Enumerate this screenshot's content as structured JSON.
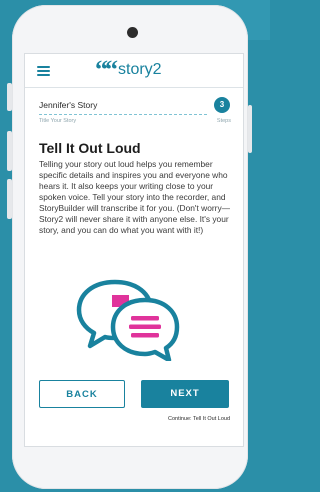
{
  "app": {
    "logo_text": "story2",
    "logo_mark": "““"
  },
  "story": {
    "name": "Jennifer's Story",
    "subtitle": "Title Your Story",
    "step_number": "3",
    "step_label": "Steps"
  },
  "content": {
    "heading": "Tell It Out Loud",
    "body": "Telling your story out loud helps you remember specific details and inspires you and everyone who hears it. It also keeps your writing close to your spoken voice. Tell your story into the recorder, and StoryBuilder will transcribe it for you. (Don't worry—Story2 will never share it with anyone else. It's your story, and you can do what you want with it!)"
  },
  "nav": {
    "back_label": "BACK",
    "next_label": "NEXT",
    "continue_note": "Continue: Tell It Out Loud"
  },
  "colors": {
    "brand": "#19829e",
    "accent": "#e0339b",
    "background": "#2b8fa8"
  },
  "icons": {
    "menu": "menu-icon",
    "illustration": "speech-bubbles-icon"
  }
}
